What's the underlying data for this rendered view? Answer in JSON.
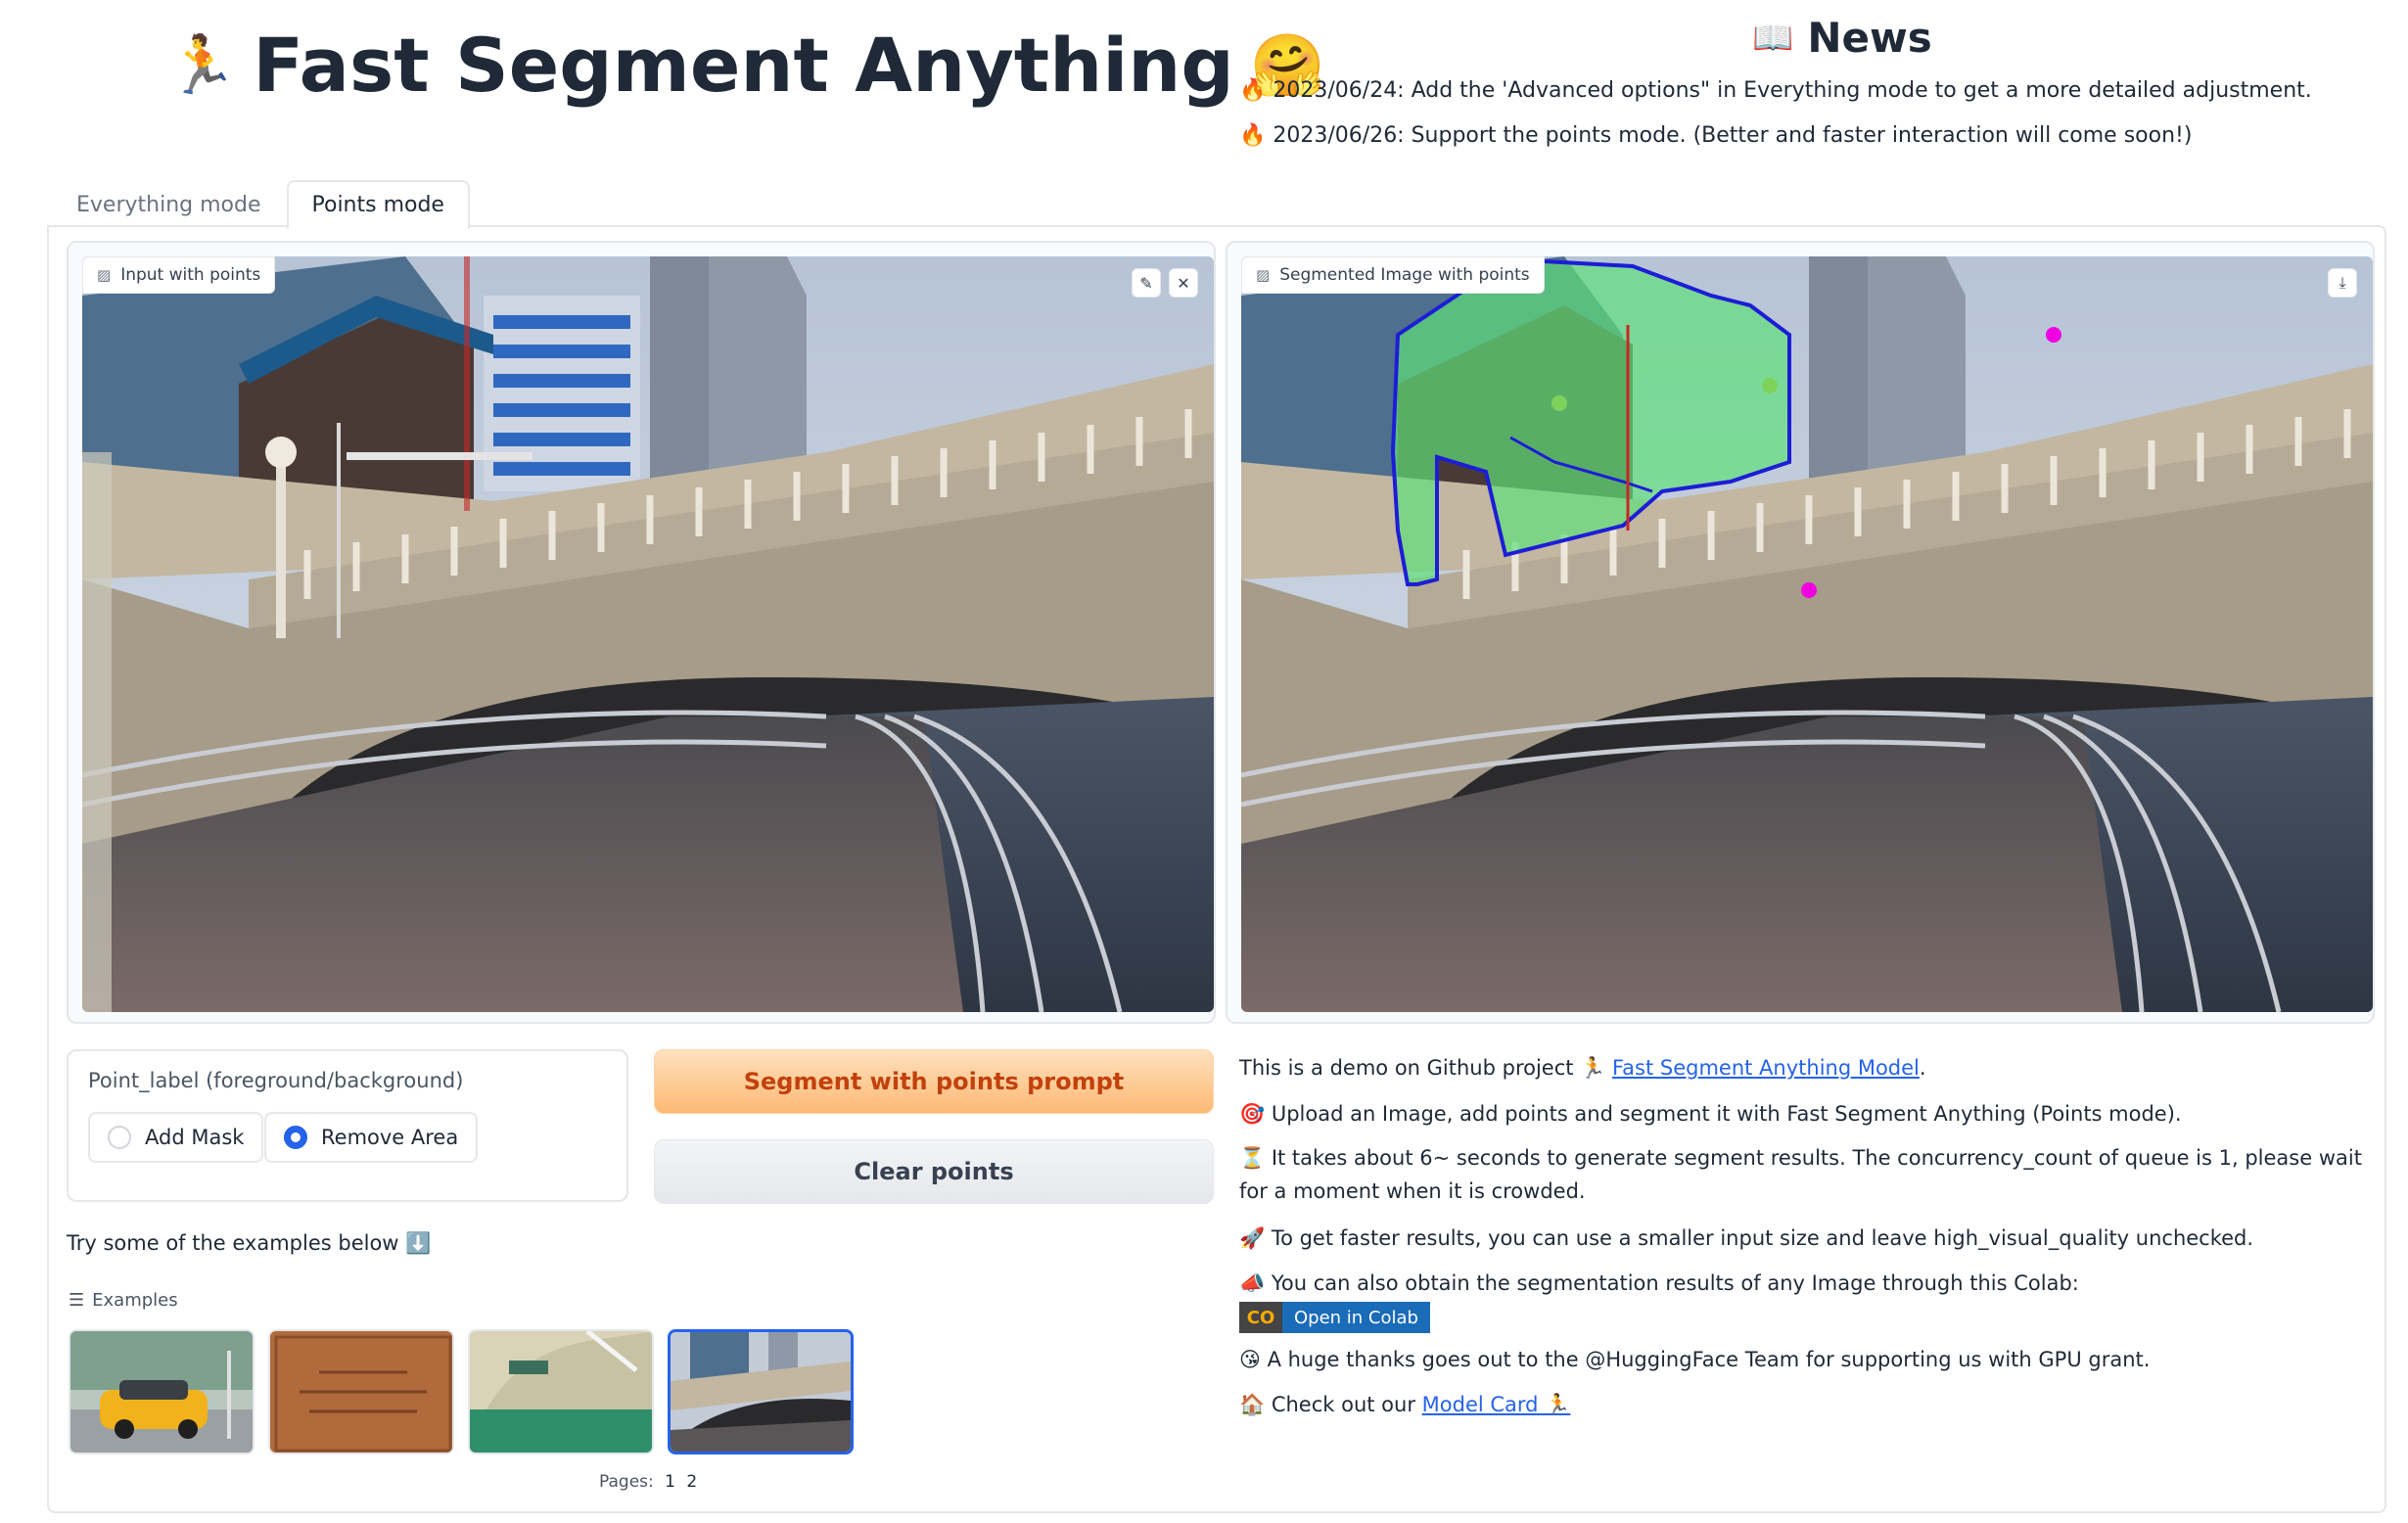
{
  "header": {
    "title_icon": "🏃",
    "title": "Fast Segment Anything",
    "title_emoji": "🤗"
  },
  "news": {
    "icon": "📖",
    "title": "News",
    "items": [
      "🔥 2023/06/24: Add the 'Advanced options\" in Everything mode to get a more detailed adjustment.",
      "🔥 2023/06/26: Support the points mode. (Better and faster interaction will come soon!)"
    ]
  },
  "tabs": [
    {
      "label": "Everything mode",
      "active": false
    },
    {
      "label": "Points mode",
      "active": true
    }
  ],
  "input_panel": {
    "label": "Input with points",
    "edit_icon": "pencil-icon",
    "close_icon": "close-icon"
  },
  "output_panel": {
    "label": "Segmented Image with points",
    "download_icon": "download-icon"
  },
  "point_label": {
    "title": "Point_label (foreground/background)",
    "options": [
      {
        "label": "Add Mask",
        "checked": false
      },
      {
        "label": "Remove Area",
        "checked": true
      }
    ]
  },
  "buttons": {
    "segment": "Segment with points prompt",
    "clear": "Clear points"
  },
  "examples": {
    "intro": "Try some of the examples below ⬇️",
    "label": "Examples",
    "pages_label": "Pages:",
    "pages": [
      "1",
      "2"
    ],
    "selected_index": 3
  },
  "description": {
    "line1_prefix": "This is a demo on Github project 🏃 ",
    "line1_link": "Fast Segment Anything Model",
    "line1_suffix": ".",
    "line2": "🎯 Upload an Image, add points and segment it with Fast Segment Anything (Points mode).",
    "line3": "⏳ It takes about 6~ seconds to generate segment results. The concurrency_count of queue is 1, please wait for a moment when it is crowded.",
    "line4": "🚀 To get faster results, you can use a smaller input size and leave high_visual_quality unchecked.",
    "line5": "📣 You can also obtain the segmentation results of any Image through this Colab:",
    "colab_logo": "CO",
    "colab_label": "Open in Colab",
    "line6": "😘 A huge thanks goes out to the @HuggingFace Team for supporting us with GPU grant.",
    "line7_prefix": "🏠 Check out our ",
    "line7_link": "Model Card 🏃"
  },
  "colors": {
    "accent": "#2563eb",
    "primary_button_text": "#c2410c",
    "mask_fill": "#5fe07a",
    "mask_outline": "#1d1dd6",
    "point_positive": "#7dd35a",
    "point_negative": "#f000e0"
  }
}
